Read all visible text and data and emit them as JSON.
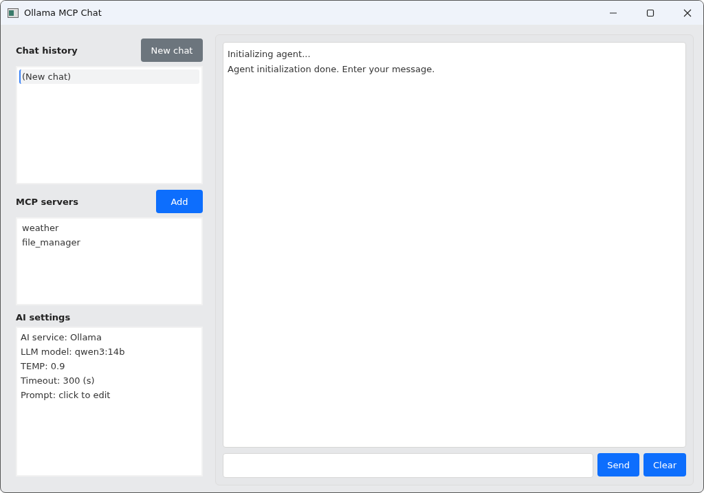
{
  "window": {
    "title": "Ollama MCP Chat"
  },
  "chat_history": {
    "title": "Chat history",
    "button": {
      "label": "New chat",
      "kind": "secondary"
    },
    "items": [
      {
        "label": "(New chat)",
        "selected": true
      }
    ]
  },
  "mcp_servers": {
    "title": "MCP servers",
    "button": {
      "label": "Add",
      "kind": "primary"
    },
    "items": [
      {
        "label": "weather",
        "selected": false
      },
      {
        "label": "file_manager",
        "selected": false
      }
    ]
  },
  "ai_settings": {
    "title": "AI settings",
    "lines": [
      "AI service: Ollama",
      "LLM model: qwen3:14b",
      "TEMP: 0.9",
      "Timeout: 300 (s)",
      "Prompt: click to edit"
    ]
  },
  "chat_log": {
    "lines": [
      "Initializing agent...",
      "Agent initialization done. Enter your message."
    ]
  },
  "buttons": [
    {
      "label": "Send",
      "kind": "primary"
    },
    {
      "label": "Clear",
      "kind": "primary"
    }
  ]
}
